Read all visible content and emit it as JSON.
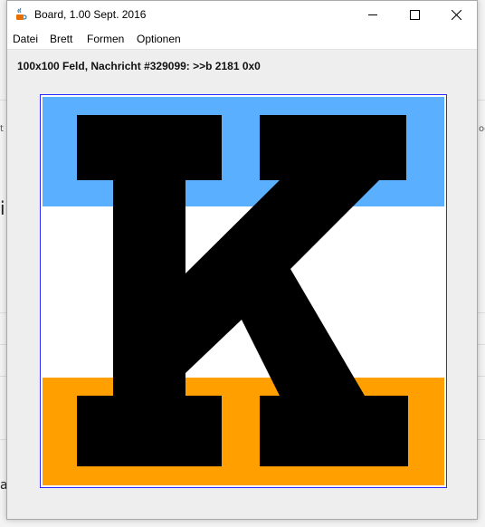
{
  "window": {
    "title": "Board, 1.00 Sept. 2016"
  },
  "menu": {
    "items": [
      "Datei",
      "Brett",
      "Formen",
      "Optionen"
    ]
  },
  "status": {
    "message": "100x100 Feld, Nachricht #329099: >>b 2181 0x0"
  },
  "board": {
    "glyph": "K",
    "colors": {
      "top_band": "#5aafff",
      "middle_band": "#ffffff",
      "bottom_band": "#ff9f00",
      "glyph": "#000000",
      "frame": "#2b2bff"
    }
  },
  "background_fragments": [
    "il",
    "ar",
    "t",
    "oe"
  ],
  "icons": {
    "app": "java-cup-icon",
    "minimize": "minimize-icon",
    "maximize": "maximize-icon",
    "close": "close-icon"
  }
}
